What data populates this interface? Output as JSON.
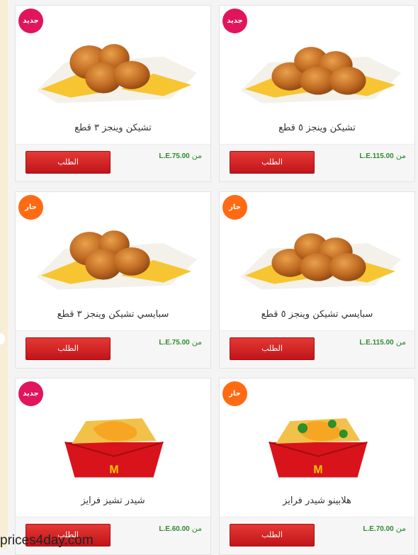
{
  "colors": {
    "new_badge": "#e0155c",
    "hot_badge": "#ff6a13",
    "price_green": "#2e8b2e",
    "button_red": "#d3181e"
  },
  "products": [
    {
      "name": "تشيكن وينجز ٥ قطع",
      "price": "L.E.115.00",
      "from": "من",
      "button": "الطلب",
      "badge": "جديد",
      "badge_type": "new",
      "image": "chicken-wings-5-pieces"
    },
    {
      "name": "تشيكن وينجز ٣ قطع",
      "price": "L.E.75.00",
      "from": "من",
      "button": "الطلب",
      "badge": "جديد",
      "badge_type": "new",
      "image": "chicken-wings-3-pieces"
    },
    {
      "name": "سبايسي تشيكن وينجز ٥ قطع",
      "price": "L.E.115.00",
      "from": "من",
      "button": "الطلب",
      "badge": "حار",
      "badge_type": "hot",
      "image": "spicy-wings-5-pieces"
    },
    {
      "name": "سبايسي تشيكن وينجز ٣ قطع",
      "price": "L.E.75.00",
      "from": "من",
      "button": "الطلب",
      "badge": "حار",
      "badge_type": "hot",
      "image": "spicy-wings-3-pieces"
    },
    {
      "name": "هلابينو شيدر فرايز",
      "price": "L.E.70.00",
      "from": "من",
      "button": "الطلب",
      "badge": "حار",
      "badge_type": "hot",
      "image": "jalapeno-cheddar-fries"
    },
    {
      "name": "شيدر تشيز فرايز",
      "price": "L.E.60.00",
      "from": "من",
      "button": "الطلب",
      "badge": "جديد",
      "badge_type": "new",
      "image": "cheddar-cheese-fries"
    }
  ],
  "watermark": "prices4day.com"
}
